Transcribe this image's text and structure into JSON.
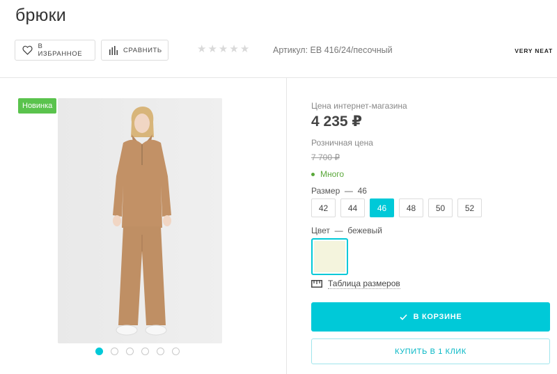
{
  "product": {
    "title": "брюки",
    "sku_text": "Артикул: ЕВ 416/24/песочный",
    "brand": "VERY NEAT",
    "badge": "Новинка",
    "rating_stars": 5,
    "rating_filled": 0
  },
  "actions": {
    "favorite_label": "В ИЗБРАННОЕ",
    "compare_label": "СРАВНИТЬ"
  },
  "pricing": {
    "online_label": "Цена интернет-магазина",
    "online_price": "4 235 ₽",
    "retail_label": "Розничная цена",
    "retail_price": "7 700 ₽",
    "stock_label": "Много"
  },
  "size": {
    "label": "Размер",
    "dash": "—",
    "selected": "46",
    "options": [
      "42",
      "44",
      "46",
      "48",
      "50",
      "52"
    ],
    "table_link": "Таблица размеров"
  },
  "color": {
    "label": "Цвет",
    "dash": "—",
    "selected": "бежевый",
    "swatch_hex": "#f4f4dd"
  },
  "cart": {
    "in_cart_label": "В КОРЗИНЕ",
    "buy_one_click_label": "КУПИТЬ В 1 КЛИК"
  },
  "gallery": {
    "slide_count": 6,
    "active_index": 0
  },
  "colors": {
    "accent": "#00c9d8",
    "new_badge": "#5ac34d",
    "stock": "#5aa83a"
  }
}
